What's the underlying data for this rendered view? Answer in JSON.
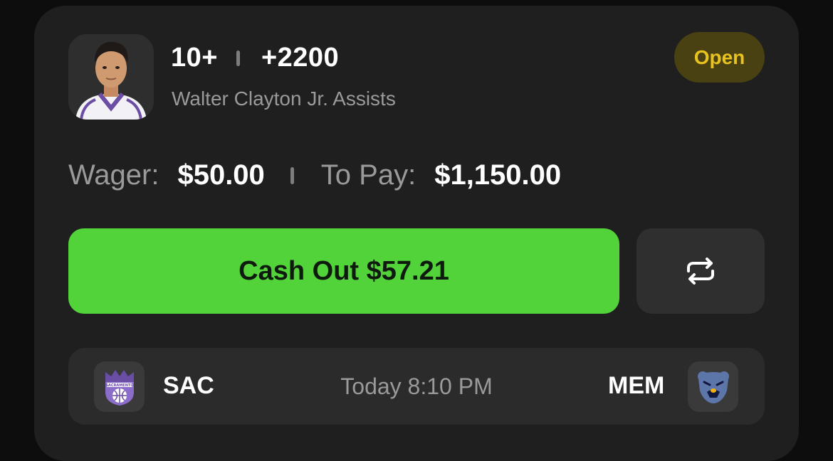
{
  "bet": {
    "line": "10+",
    "odds": "+2200",
    "market": "Walter Clayton Jr. Assists",
    "status": "Open",
    "wager_label": "Wager:",
    "wager_value": "$50.00",
    "topay_label": "To Pay:",
    "topay_value": "$1,150.00"
  },
  "actions": {
    "cashout_label": "Cash Out $57.21",
    "refresh_icon": "repeat-icon"
  },
  "game": {
    "home_abbr": "SAC",
    "away_abbr": "MEM",
    "time": "Today 8:10 PM"
  },
  "colors": {
    "accent_green": "#53d33a",
    "status_text": "#e8c21d",
    "status_bg": "#4a4113",
    "card_bg": "#1f1f1f"
  }
}
